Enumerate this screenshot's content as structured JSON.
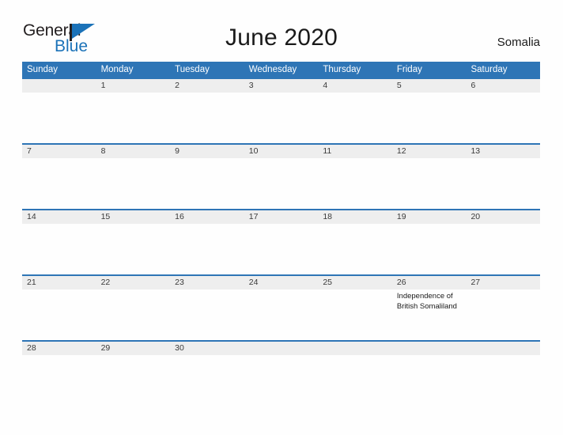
{
  "brand": {
    "name_part1": "General",
    "name_part2": "Blue",
    "flag_icon": "flag-icon",
    "color_dark": "#231f20",
    "color_blue": "#1b72b8"
  },
  "header": {
    "title": "June 2020",
    "country": "Somalia"
  },
  "calendar": {
    "header_bg": "#2e75b6",
    "date_band_bg": "#eeeeee",
    "weekdays": [
      "Sunday",
      "Monday",
      "Tuesday",
      "Wednesday",
      "Thursday",
      "Friday",
      "Saturday"
    ],
    "weeks": [
      {
        "days": [
          {
            "date": "",
            "event": ""
          },
          {
            "date": "1",
            "event": ""
          },
          {
            "date": "2",
            "event": ""
          },
          {
            "date": "3",
            "event": ""
          },
          {
            "date": "4",
            "event": ""
          },
          {
            "date": "5",
            "event": ""
          },
          {
            "date": "6",
            "event": ""
          }
        ]
      },
      {
        "days": [
          {
            "date": "7",
            "event": ""
          },
          {
            "date": "8",
            "event": ""
          },
          {
            "date": "9",
            "event": ""
          },
          {
            "date": "10",
            "event": ""
          },
          {
            "date": "11",
            "event": ""
          },
          {
            "date": "12",
            "event": ""
          },
          {
            "date": "13",
            "event": ""
          }
        ]
      },
      {
        "days": [
          {
            "date": "14",
            "event": ""
          },
          {
            "date": "15",
            "event": ""
          },
          {
            "date": "16",
            "event": ""
          },
          {
            "date": "17",
            "event": ""
          },
          {
            "date": "18",
            "event": ""
          },
          {
            "date": "19",
            "event": ""
          },
          {
            "date": "20",
            "event": ""
          }
        ]
      },
      {
        "days": [
          {
            "date": "21",
            "event": ""
          },
          {
            "date": "22",
            "event": ""
          },
          {
            "date": "23",
            "event": ""
          },
          {
            "date": "24",
            "event": ""
          },
          {
            "date": "25",
            "event": ""
          },
          {
            "date": "26",
            "event": "Independence of British Somaliland"
          },
          {
            "date": "27",
            "event": ""
          }
        ]
      },
      {
        "days": [
          {
            "date": "28",
            "event": ""
          },
          {
            "date": "29",
            "event": ""
          },
          {
            "date": "30",
            "event": ""
          },
          {
            "date": "",
            "event": ""
          },
          {
            "date": "",
            "event": ""
          },
          {
            "date": "",
            "event": ""
          },
          {
            "date": "",
            "event": ""
          }
        ]
      }
    ]
  }
}
